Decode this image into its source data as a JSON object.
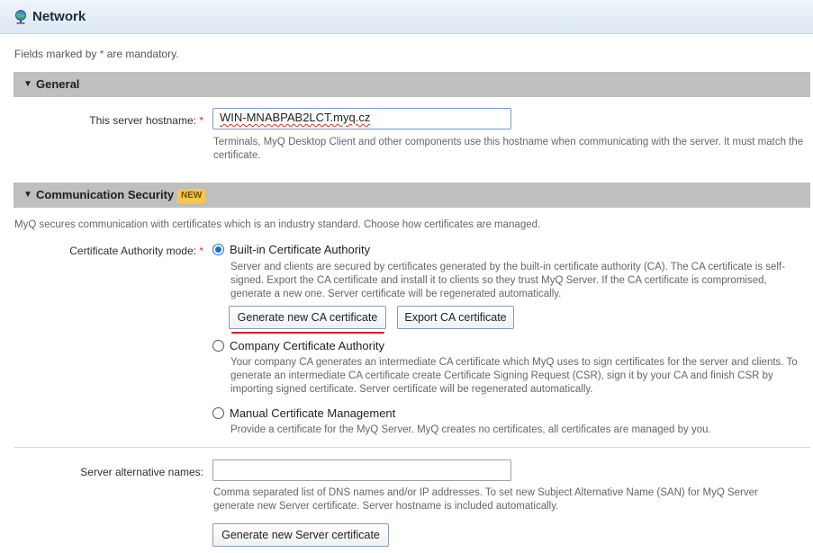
{
  "header": {
    "title": "Network",
    "icon": "network-globe-icon"
  },
  "mandatory": {
    "prefix": "Fields marked by ",
    "star": "*",
    "suffix": " are mandatory."
  },
  "general": {
    "title": "General",
    "hostname_label": "This server hostname:",
    "star": "*",
    "hostname_value": "WIN-MNABPAB2LCT.myq.cz",
    "hostname_help": "Terminals, MyQ Desktop Client and other components use this hostname when communicating with the server. It must match the certificate."
  },
  "security": {
    "title": "Communication Security",
    "badge": "NEW",
    "description": "MyQ secures communication with certificates which is an industry standard. Choose how certificates are managed.",
    "ca_mode_label": "Certificate Authority mode:",
    "star": "*",
    "options": [
      {
        "label": "Built-in Certificate Authority",
        "checked": true,
        "help": "Server and clients are secured by certificates generated by the built-in certificate authority (CA). The CA certificate is self-signed. Export the CA certificate and install it to clients so they trust MyQ Server. If the CA certificate is compromised, generate a new one. Server certificate will be regenerated automatically."
      },
      {
        "label": "Company Certificate Authority",
        "checked": false,
        "help": "Your company CA generates an intermediate CA certificate which MyQ uses to sign certificates for the server and clients. To generate an intermediate CA certificate create Certificate Signing Request (CSR), sign it by your CA and finish CSR by importing signed certificate. Server certificate will be regenerated automatically."
      },
      {
        "label": "Manual Certificate Management",
        "checked": false,
        "help": "Provide a certificate for the MyQ Server. MyQ creates no certificates, all certificates are managed by you."
      }
    ],
    "generate_ca_button": "Generate new CA certificate",
    "export_ca_button": "Export CA certificate",
    "alt_names_label": "Server alternative names:",
    "alt_names_value": "",
    "alt_names_help": "Comma separated list of DNS names and/or IP addresses. To set new Subject Alternative Name (SAN) for MyQ Server generate new Server certificate. Server hostname is included automatically.",
    "generate_server_button": "Generate new Server certificate"
  },
  "colors": {
    "accent": "#1a6fd1",
    "required": "#d9331f",
    "highlight": "#e0191f",
    "badge": "#f5c84c"
  }
}
